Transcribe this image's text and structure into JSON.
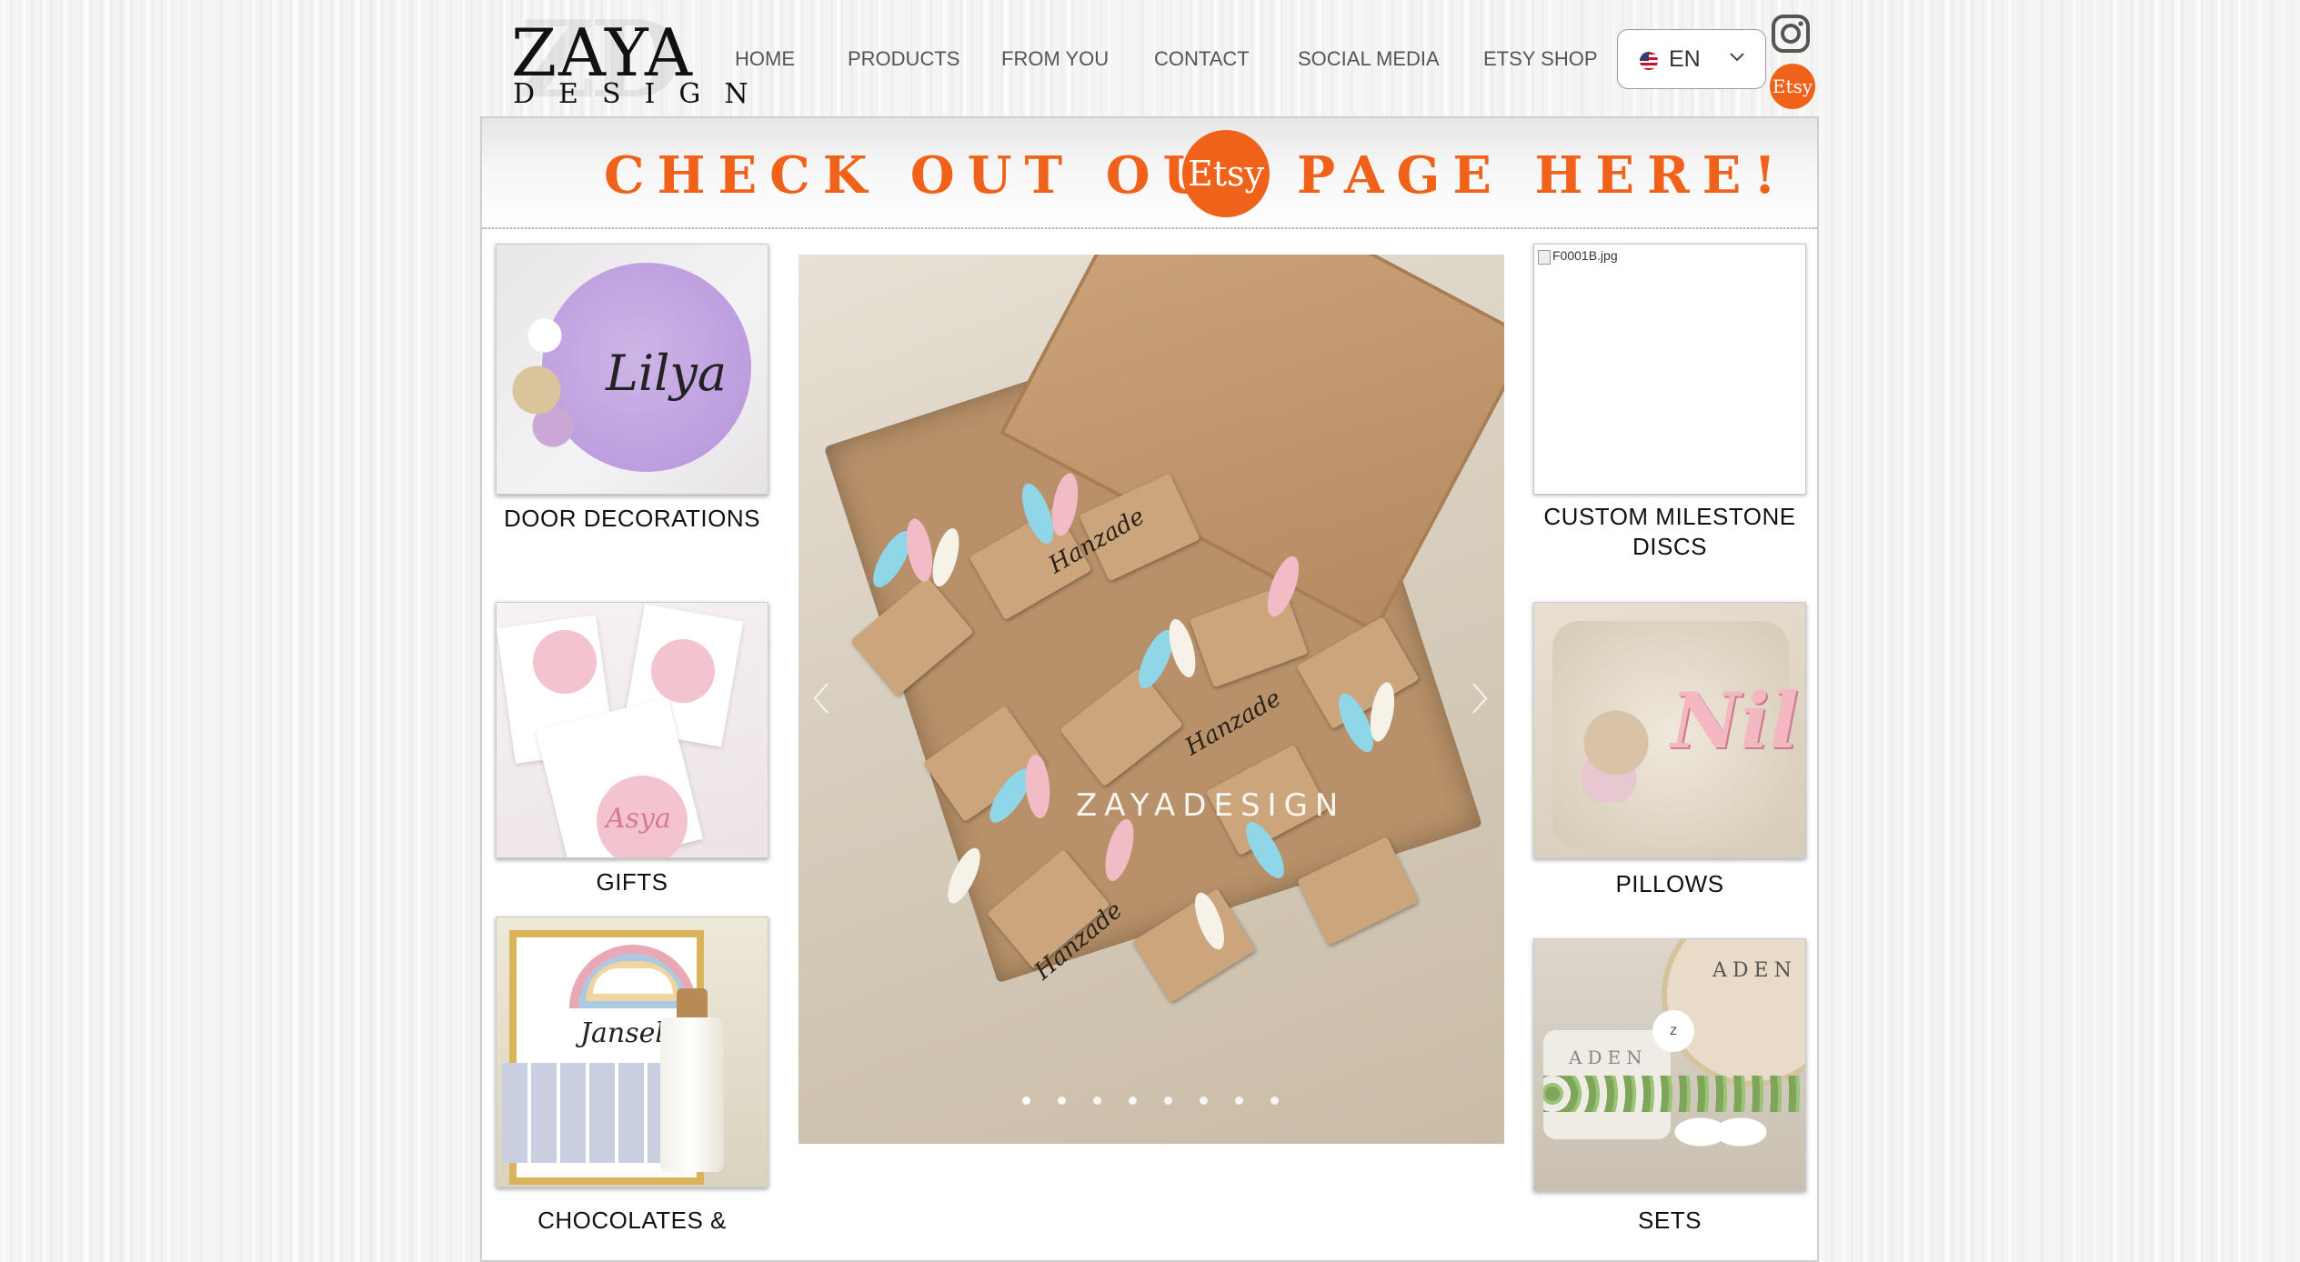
{
  "header": {
    "logo_text": "ZAYA",
    "logo_subtext": "DESIGN",
    "logo_watermark": "ZD",
    "nav": [
      {
        "label": "HOME"
      },
      {
        "label": "PRODUCTS"
      },
      {
        "label": "FROM YOU"
      },
      {
        "label": "CONTACT"
      },
      {
        "label": "SOCIAL MEDIA"
      },
      {
        "label": "ETSY SHOP"
      }
    ],
    "language": {
      "code": "EN",
      "flag": "us-flag-icon"
    },
    "social": {
      "instagram": "instagram-icon",
      "etsy": "Etsy"
    }
  },
  "banner": {
    "left_text": "CHECK OUT OUR",
    "etsy_logo": "Etsy",
    "right_text": "PAGE HERE!",
    "color": "#f0621a"
  },
  "categories": {
    "door": {
      "caption": "DOOR DECORATIONS",
      "art_text": "Lilya"
    },
    "gifts": {
      "caption": "GIFTS",
      "art_text": "Asya"
    },
    "chocolates": {
      "caption": "CHOCOLATES &",
      "art_text": "Jansel"
    },
    "discs": {
      "caption": "CUSTOM MILESTONE DISCS",
      "image_alt": "F0001B.jpg"
    },
    "pillows": {
      "caption": "PILLOWS",
      "art_text": "Nil"
    },
    "sets": {
      "caption": "SETS",
      "art_text": "ADEN"
    }
  },
  "slideshow": {
    "watermark": "ZAYADESIGN",
    "favor_text": "Hanzade",
    "dot_count": 8,
    "active_index": 0
  },
  "colors": {
    "accent": "#f0621a",
    "nav_text": "#555555",
    "border": "#cfcfcf"
  }
}
